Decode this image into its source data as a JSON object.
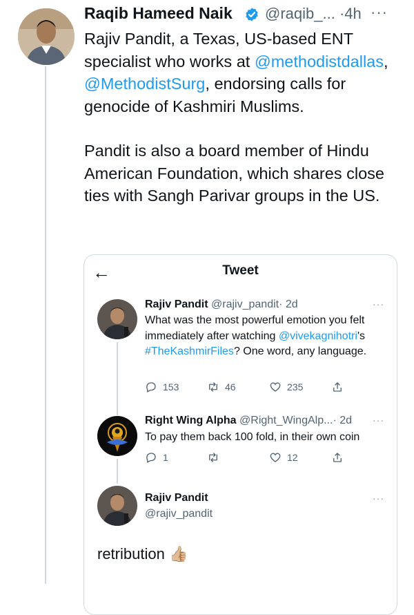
{
  "main_tweet": {
    "author_name": "Raqib Hameed Naik",
    "handle": "@raqib_...",
    "separator": "·",
    "time": "4h",
    "more": "···",
    "para1_text1": "Rajiv Pandit, a Texas, US-based ENT specialist who works at ",
    "para1_mention1": "@methodistdallas",
    "para1_sep": ", ",
    "para1_mention2": "@MethodistSurg",
    "para1_text2": ", endorsing calls for genocide of Kashmiri Muslims.",
    "para2": "Pandit is also a board member of Hindu American Foundation, which shares close ties with Sangh Parivar groups in the US."
  },
  "quoted_screenshot": {
    "back_glyph": "←",
    "title": "Tweet",
    "tweet1": {
      "name": "Rajiv Pandit",
      "handle": "@rajiv_pandit",
      "time": "· 2d",
      "more": "···",
      "text1": "What was the most powerful emotion you felt immediately after watching ",
      "mention": "@vivekagnihotri",
      "text2": "'s ",
      "hashtag": "#TheKashmirFiles",
      "text3": "? One word, any language.",
      "replies": "153",
      "retweets": "46",
      "likes": "235"
    },
    "tweet2": {
      "name": "Right Wing Alpha",
      "handle": "@Right_WingAlp...",
      "time": "· 2d",
      "more": "···",
      "text": "To pay them back 100 fold, in their own coin",
      "replies": "1",
      "retweets": "",
      "likes": "12"
    },
    "tweet3": {
      "name": "Rajiv Pandit",
      "handle": "@rajiv_pandit",
      "more": "···",
      "text": "retribution",
      "emoji": "👍🏼"
    }
  },
  "colors": {
    "link": "#1d9bf0",
    "verified": "#1d9bf0",
    "muted_text": "#536471",
    "border": "#cfd9de"
  }
}
